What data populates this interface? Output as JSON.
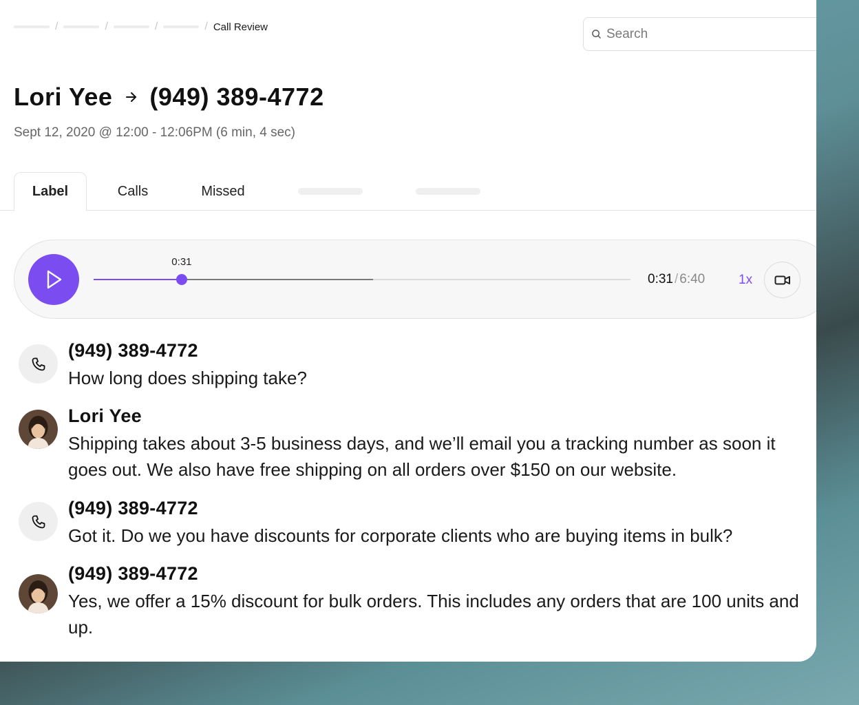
{
  "breadcrumb": {
    "current": "Call Review"
  },
  "search": {
    "placeholder": "Search"
  },
  "header": {
    "caller": "Lori Yee",
    "callee": "(949) 389-4772",
    "subtitle": "Sept 12, 2020 @ 12:00 - 12:06PM (6 min, 4 sec)"
  },
  "tabs": [
    {
      "label": "Label",
      "active": true
    },
    {
      "label": "Calls",
      "active": false
    },
    {
      "label": "Missed",
      "active": false
    }
  ],
  "player": {
    "thumb_label": "0:31",
    "current": "0:31",
    "separator": "/",
    "total": "6:40",
    "speed": "1x",
    "progress_fraction": 0.164,
    "buffered_fraction": 0.52,
    "accent_color": "#7b4df0"
  },
  "transcript": [
    {
      "speaker": "(949) 389-4772",
      "avatar": "phone-icon",
      "text": "How long does shipping take?"
    },
    {
      "speaker": "Lori Yee",
      "avatar": "user-avatar",
      "text": "Shipping takes about 3-5 business days, and we’ll email you a tracking number as soon it goes out. We also have free shipping on all orders over $150 on our website."
    },
    {
      "speaker": "(949) 389-4772",
      "avatar": "phone-icon",
      "text": "Got it. Do we you have discounts for corporate clients who are buying items in bulk?"
    },
    {
      "speaker": "(949) 389-4772",
      "avatar": "user-avatar",
      "text": "Yes, we offer a 15% discount for bulk orders. This includes any orders that are 100 units and up."
    }
  ]
}
